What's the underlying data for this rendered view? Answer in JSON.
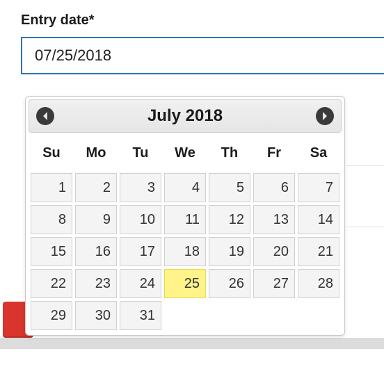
{
  "field": {
    "label": "Entry date*",
    "value": "07/25/2018"
  },
  "datepicker": {
    "title": "July 2018",
    "weekdays": [
      "Su",
      "Mo",
      "Tu",
      "We",
      "Th",
      "Fr",
      "Sa"
    ],
    "weeks": [
      [
        1,
        2,
        3,
        4,
        5,
        6,
        7
      ],
      [
        8,
        9,
        10,
        11,
        12,
        13,
        14
      ],
      [
        15,
        16,
        17,
        18,
        19,
        20,
        21
      ],
      [
        22,
        23,
        24,
        25,
        26,
        27,
        28
      ],
      [
        29,
        30,
        31,
        null,
        null,
        null,
        null
      ]
    ],
    "selected_day": 25
  }
}
